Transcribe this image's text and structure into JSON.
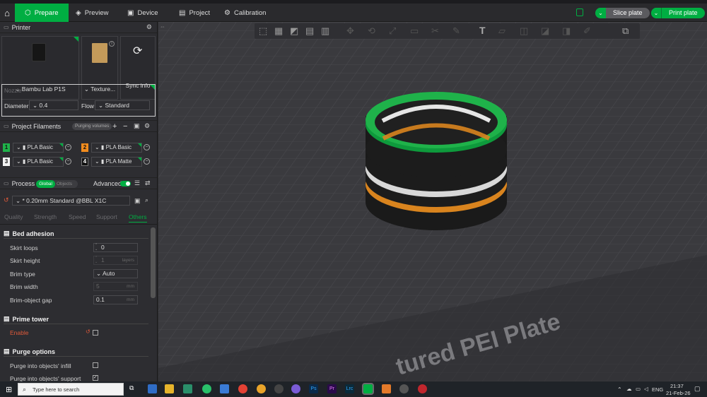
{
  "app": {
    "tabs": [
      {
        "label": "Prepare",
        "icon": "cube-icon"
      },
      {
        "label": "Preview",
        "icon": "preview-icon"
      },
      {
        "label": "Device",
        "icon": "device-icon"
      },
      {
        "label": "Project",
        "icon": "project-icon"
      },
      {
        "label": "Calibration",
        "icon": "calibration-icon"
      }
    ],
    "slice_label": "Slice plate",
    "print_label": "Print plate",
    "accent": "#00ae42"
  },
  "printer": {
    "header": "Printer",
    "printer_name": "Bambu Lab P1S",
    "plate_name": "Texture...",
    "sync_label": "Sync info",
    "nozzle_label": "Nozzle",
    "diameter_label": "Diameter",
    "diameter_value": "0.4",
    "flow_label": "Flow",
    "flow_value": "Standard"
  },
  "filaments": {
    "header": "Project Filaments",
    "purging_label": "Purging volumes",
    "items": [
      {
        "num": "1",
        "name": "PLA Basic",
        "color": "#1fb24a"
      },
      {
        "num": "2",
        "name": "PLA Basic",
        "color": "#f28c1e"
      },
      {
        "num": "3",
        "name": "PLA Basic",
        "color": "#f2f2f2"
      },
      {
        "num": "4",
        "name": "PLA Matte",
        "color": "#111111"
      }
    ]
  },
  "process": {
    "header": "Process",
    "global_label": "Global",
    "objects_label": "Objects",
    "advanced_label": "Advanced",
    "preset": "* 0.20mm Standard @BBL X1C",
    "subtabs": [
      "Quality",
      "Strength",
      "Speed",
      "Support",
      "Others"
    ],
    "bed_adhesion": {
      "title": "Bed adhesion",
      "skirt_loops_label": "Skirt loops",
      "skirt_loops_value": "0",
      "skirt_height_label": "Skirt height",
      "skirt_height_value": "1",
      "skirt_height_unit": "layers",
      "brim_type_label": "Brim type",
      "brim_type_value": "Auto",
      "brim_width_label": "Brim width",
      "brim_width_value": "5",
      "brim_width_unit": "mm",
      "brim_gap_label": "Brim-object gap",
      "brim_gap_value": "0.1",
      "brim_gap_unit": "mm"
    },
    "prime_tower": {
      "title": "Prime tower",
      "enable_label": "Enable"
    },
    "purge": {
      "title": "Purge options",
      "infill_label": "Purge into objects' infill",
      "support_label": "Purge into objects' support"
    }
  },
  "viewport": {
    "plate_text": "tured PEI Plate"
  },
  "taskbar": {
    "search_placeholder": "Type here to search",
    "lang": "ENG",
    "time": "21:37",
    "date": "21-Feb-26"
  }
}
